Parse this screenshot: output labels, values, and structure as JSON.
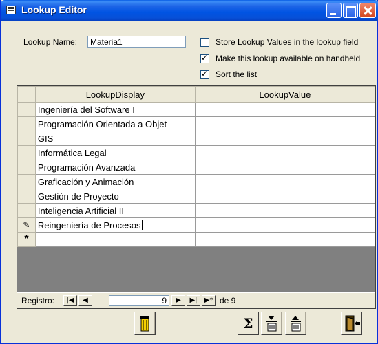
{
  "window": {
    "title": "Lookup Editor"
  },
  "form": {
    "lookup_name_label": "Lookup Name:",
    "lookup_name_value": "Materia1",
    "options": [
      {
        "label": "Store Lookup Values in the lookup field",
        "checked": false
      },
      {
        "label": "Make this lookup available on handheld",
        "checked": true
      },
      {
        "label": "Sort the list",
        "checked": true
      }
    ]
  },
  "grid": {
    "columns": [
      "LookupDisplay",
      "LookupValue"
    ],
    "rows": [
      [
        "Ingeniería del Software I",
        ""
      ],
      [
        "Programación Orientada a Objet",
        ""
      ],
      [
        "GIS",
        ""
      ],
      [
        "Informática Legal",
        ""
      ],
      [
        "Programación Avanzada",
        ""
      ],
      [
        "Graficación y Animación",
        ""
      ],
      [
        "Gestión de Proyecto",
        ""
      ],
      [
        "Inteligencia Artificial II",
        ""
      ],
      [
        "Reingeniería de Procesos",
        ""
      ]
    ],
    "new_row_marker": "*",
    "edit_marker": "✎"
  },
  "navigation": {
    "record_label": "Registro:",
    "current_record": "9",
    "of_label": "de 9"
  },
  "toolbar": {
    "buttons": [
      "delete-icon",
      "sum-icon",
      "move-down-icon",
      "move-up-icon",
      "exit-icon"
    ],
    "sigma": "Σ"
  }
}
